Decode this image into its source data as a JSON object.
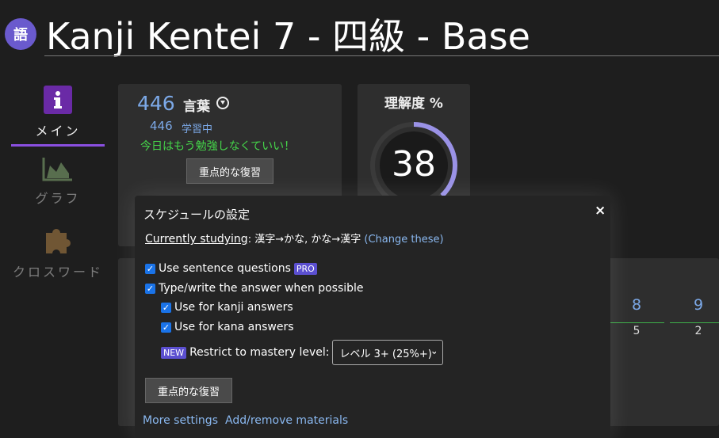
{
  "header": {
    "logo_char": "語",
    "title": "Kanji Kentei 7 - 四級 - Base"
  },
  "sidebar": {
    "items": [
      {
        "label": "メイン",
        "icon": "info-icon",
        "active": true
      },
      {
        "label": "グラフ",
        "icon": "area-chart-icon",
        "active": false
      },
      {
        "label": "クロスワード",
        "icon": "puzzle-icon",
        "active": false
      }
    ]
  },
  "study_card": {
    "total_count": "446",
    "total_label": "言葉",
    "learning_count": "446",
    "learning_label": "学習中",
    "done_message": "今日はもう勉強しなくていい！",
    "review_button": "重点的な復習"
  },
  "mastery_card": {
    "title": "理解度 %",
    "value": "38",
    "progress": 0.38
  },
  "level_grid": {
    "cols": [
      {
        "num": "8",
        "count": "5"
      },
      {
        "num": "9",
        "count": "2"
      }
    ]
  },
  "modal": {
    "title": "スケジュールの設定",
    "close": "×",
    "currently_studying_label": "Currently studying",
    "currently_studying_value": ": 漢字→かな, かな→漢字",
    "change_link": "(Change these)",
    "options": {
      "sentence_questions": "Use sentence questions",
      "pro_tag": "PRO",
      "type_answer": "Type/write the answer when possible",
      "kanji_answers": "Use for kanji answers",
      "kana_answers": "Use for kana answers",
      "new_tag": "NEW",
      "restrict_label": "Restrict to mastery level:",
      "restrict_value": "レベル 3+ (25%+)"
    },
    "review_button": "重点的な復習",
    "more_settings": "More settings",
    "add_remove": "Add/remove materials"
  },
  "colors": {
    "accent": "#8a4fe0",
    "link": "#8ab8f0",
    "count_blue": "#7ca9e8",
    "success_green": "#45d64a",
    "ring": "#9a92e6"
  }
}
